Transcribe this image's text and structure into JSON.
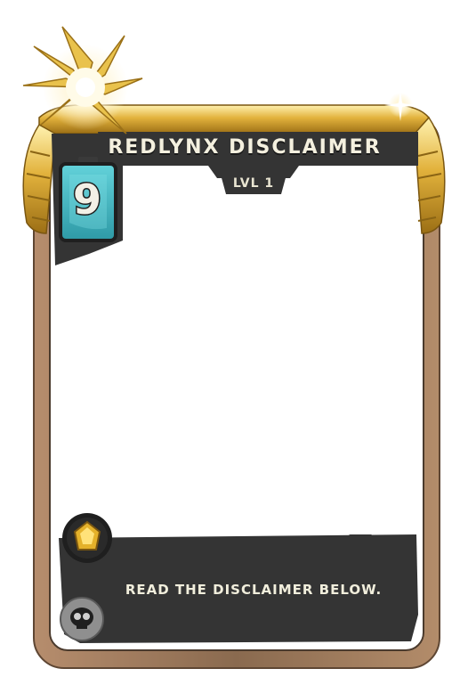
{
  "card": {
    "name": "REDLYNX DISCLAIMER",
    "level": "LVL 1",
    "mana_cost": "9",
    "ability_text": "READ THE DISCLAIMER BELOW."
  },
  "icons": {
    "mana": "battery-icon",
    "rarity": "gem-icon",
    "edition": "skull-icon",
    "burst": "sparkle-burst-icon"
  },
  "colors": {
    "gold": "#d6a631",
    "bronze_frame": "#9c7a5c",
    "dark_panel": "#333333",
    "mana_teal": "#3fb8c4",
    "text": "#f1eedc"
  }
}
